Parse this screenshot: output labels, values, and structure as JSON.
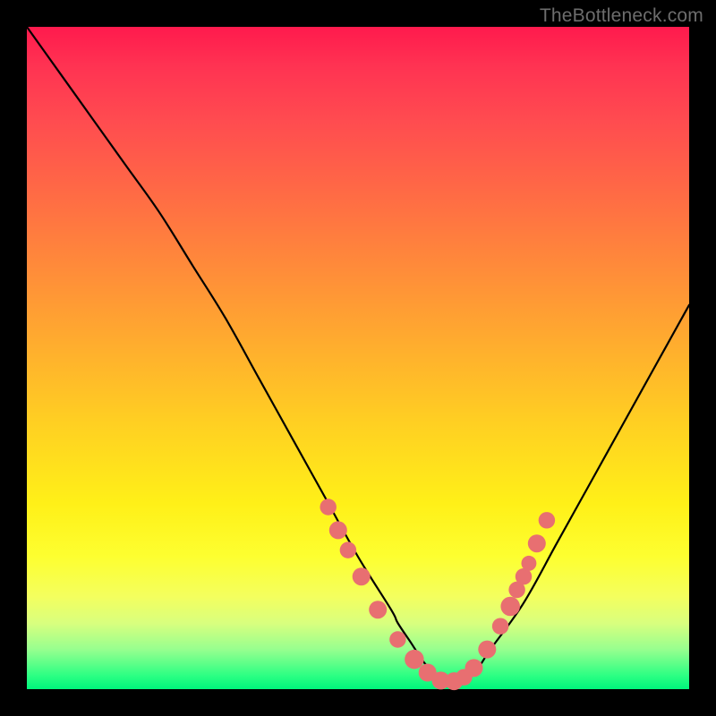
{
  "watermark": "TheBottleneck.com",
  "gradient": {
    "top": "#ff1a4d",
    "mid": "#ffd022",
    "bottom": "#00f57c"
  },
  "chart_data": {
    "type": "line",
    "title": "",
    "xlabel": "",
    "ylabel": "",
    "xlim": [
      0,
      100
    ],
    "ylim": [
      0,
      100
    ],
    "grid": false,
    "legend": false,
    "series": [
      {
        "name": "bottleneck-curve",
        "x": [
          0,
          5,
          10,
          15,
          20,
          25,
          30,
          35,
          40,
          45,
          50,
          55,
          56,
          58,
          60,
          62,
          64,
          66,
          68,
          70,
          75,
          80,
          85,
          90,
          95,
          100
        ],
        "values": [
          100,
          93,
          86,
          79,
          72,
          64,
          56,
          47,
          38,
          29,
          20,
          12,
          10,
          7,
          4,
          2,
          1,
          1,
          3,
          6,
          13,
          22,
          31,
          40,
          49,
          58
        ]
      }
    ],
    "highlight_region": {
      "name": "low-bottleneck-dots",
      "dots": [
        {
          "x": 45.5,
          "y": 27.5,
          "r": 2.4
        },
        {
          "x": 47.0,
          "y": 24.0,
          "r": 2.6
        },
        {
          "x": 48.5,
          "y": 21.0,
          "r": 2.4
        },
        {
          "x": 50.5,
          "y": 17.0,
          "r": 2.6
        },
        {
          "x": 53.0,
          "y": 12.0,
          "r": 2.6
        },
        {
          "x": 56.0,
          "y": 7.5,
          "r": 2.4
        },
        {
          "x": 58.5,
          "y": 4.5,
          "r": 2.8
        },
        {
          "x": 60.5,
          "y": 2.5,
          "r": 2.6
        },
        {
          "x": 62.5,
          "y": 1.3,
          "r": 2.6
        },
        {
          "x": 64.5,
          "y": 1.2,
          "r": 2.6
        },
        {
          "x": 66.0,
          "y": 1.8,
          "r": 2.4
        },
        {
          "x": 67.5,
          "y": 3.2,
          "r": 2.6
        },
        {
          "x": 69.5,
          "y": 6.0,
          "r": 2.6
        },
        {
          "x": 71.5,
          "y": 9.5,
          "r": 2.4
        },
        {
          "x": 73.0,
          "y": 12.5,
          "r": 2.8
        },
        {
          "x": 74.0,
          "y": 15.0,
          "r": 2.4
        },
        {
          "x": 75.0,
          "y": 17.0,
          "r": 2.4
        },
        {
          "x": 75.8,
          "y": 19.0,
          "r": 2.2
        },
        {
          "x": 77.0,
          "y": 22.0,
          "r": 2.6
        },
        {
          "x": 78.5,
          "y": 25.5,
          "r": 2.4
        }
      ],
      "color": "#e86f71"
    }
  }
}
